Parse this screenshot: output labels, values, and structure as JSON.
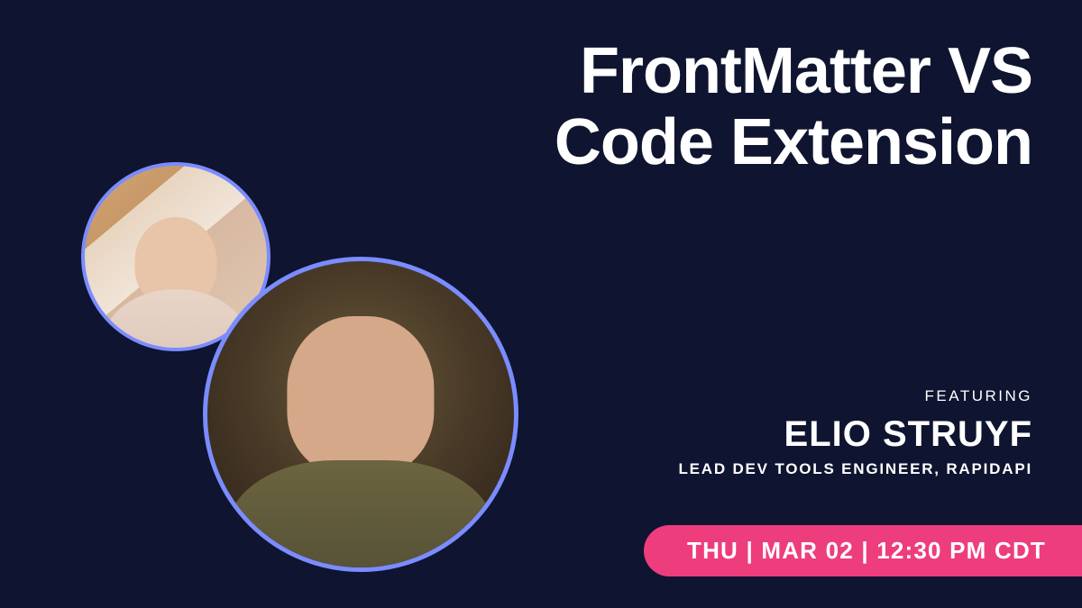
{
  "title": {
    "line1": "FrontMatter VS",
    "line2": "Code Extension"
  },
  "featuring": {
    "label": "FEATURING",
    "name": "ELIO STRUYF",
    "role": "LEAD DEV TOOLS ENGINEER, RAPIDAPI"
  },
  "datetime": "THU | MAR 02 | 12:30 PM CDT",
  "avatars": {
    "host": "host-avatar",
    "guest": "guest-avatar"
  }
}
